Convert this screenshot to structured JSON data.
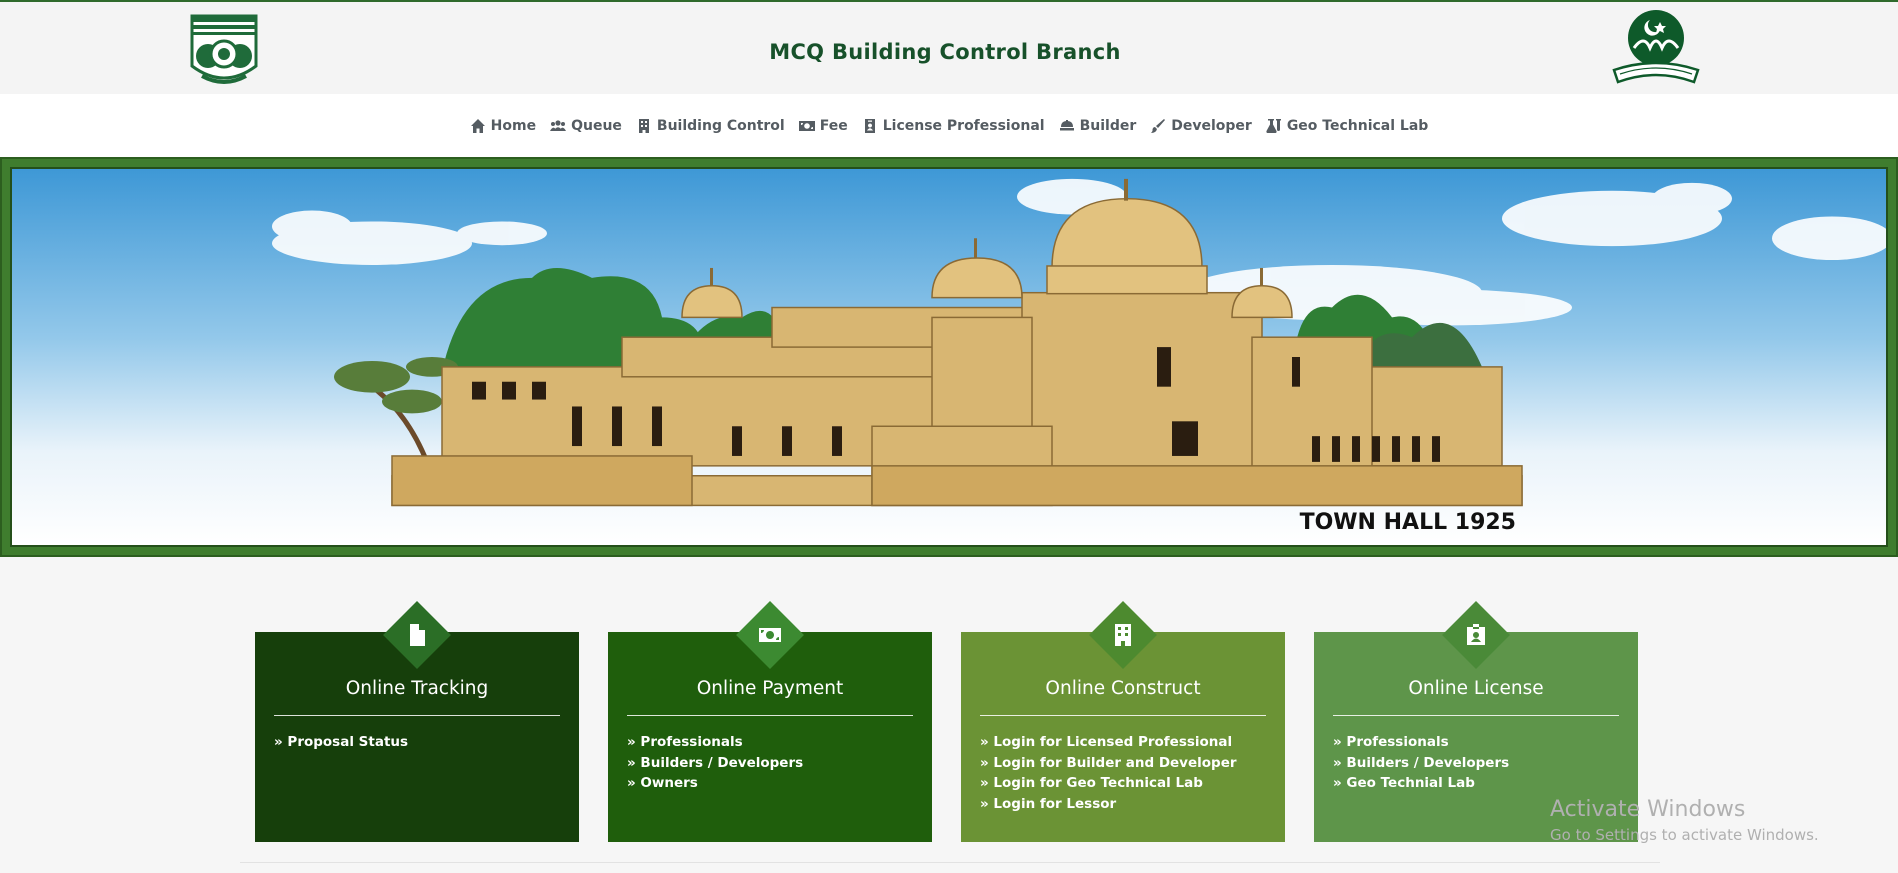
{
  "header": {
    "title": "MCQ Building Control Branch"
  },
  "nav": {
    "items": [
      {
        "label": "Home",
        "icon": "home-icon"
      },
      {
        "label": "Queue",
        "icon": "users-icon"
      },
      {
        "label": "Building Control",
        "icon": "building-icon"
      },
      {
        "label": "Fee",
        "icon": "money-icon"
      },
      {
        "label": "License Professional",
        "icon": "id-badge-icon"
      },
      {
        "label": "Builder",
        "icon": "crane-icon"
      },
      {
        "label": "Developer",
        "icon": "brush-icon"
      },
      {
        "label": "Geo Technical Lab",
        "icon": "flask-icon"
      }
    ]
  },
  "banner": {
    "caption": "TOWN HALL 1925"
  },
  "cards": [
    {
      "title": "Online Tracking",
      "icon": "file-icon",
      "links": [
        "» Proposal Status"
      ]
    },
    {
      "title": "Online Payment",
      "icon": "money-bill-icon",
      "links": [
        "» Professionals",
        "» Builders / Developers",
        "» Owners"
      ]
    },
    {
      "title": "Online Construct",
      "icon": "building-icon",
      "links": [
        "» Login for Licensed Professional",
        "» Login for Builder and Developer",
        "» Login for Geo Technical Lab",
        "» Login for Lessor"
      ]
    },
    {
      "title": "Online License",
      "icon": "id-badge-icon",
      "links": [
        "» Professionals",
        "» Builders / Developers",
        "» Geo Technial Lab"
      ]
    }
  ],
  "watermark": {
    "line1": "Activate Windows",
    "line2": "Go to Settings to activate Windows."
  },
  "colors": {
    "brand_green": "#17512a",
    "banner_frame": "#3f7d2e",
    "card1": "#163f0b",
    "card2": "#1f5e0c",
    "card3": "#6b9335",
    "card4": "#5e954a"
  }
}
